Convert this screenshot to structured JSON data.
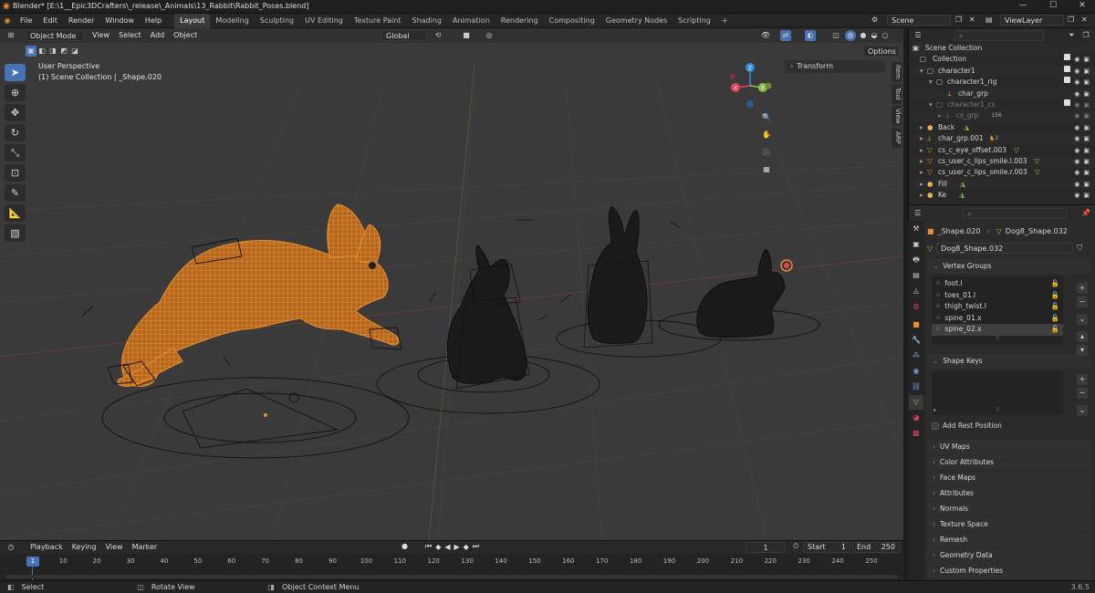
{
  "window": {
    "title": "Blender* [E:\\1__Epic3DCrafters\\_release\\_Animals\\13_Rabbit\\Rabbit_Poses.blend]",
    "minimize": "—",
    "maximize": "☐",
    "close": "✕"
  },
  "menubar": {
    "items": [
      "File",
      "Edit",
      "Render",
      "Window",
      "Help"
    ],
    "workspace_tabs": [
      "Layout",
      "Modeling",
      "Sculpting",
      "UV Editing",
      "Texture Paint",
      "Shading",
      "Animation",
      "Rendering",
      "Compositing",
      "Geometry Nodes",
      "Scripting"
    ],
    "active_tab": "Layout",
    "add_tab": "+",
    "scene_label": "Scene",
    "view_layer_label": "ViewLayer"
  },
  "viewport": {
    "mode": "Object Mode",
    "menus": [
      "View",
      "Select",
      "Add",
      "Object"
    ],
    "transform_orientation": "Global",
    "options_label": "Options",
    "perspective_text": "User Perspective",
    "collection_text": "(1) Scene Collection | _Shape.020",
    "transform_panel": "Transform",
    "side_tabs": [
      "Item",
      "Tool",
      "View",
      "ARP"
    ],
    "gizmo_axes": [
      "Z",
      "X",
      "Y"
    ]
  },
  "outliner": {
    "search_placeholder": "",
    "root": "Scene Collection",
    "rows": [
      {
        "name": "Collection",
        "dim": false,
        "icon": "collection-icon"
      },
      {
        "name": "character1",
        "dim": false,
        "icon": "collection-icon"
      },
      {
        "name": "character1_rig",
        "dim": false,
        "icon": "collection-icon"
      },
      {
        "name": "char_grp",
        "dim": false,
        "icon": "armature-icon"
      },
      {
        "name": "character1_cs",
        "dim": true,
        "icon": "collection-icon"
      },
      {
        "name": "cs_grp",
        "dim": true,
        "icon": "empty-icon",
        "badge": "156"
      },
      {
        "name": "Back",
        "dim": false,
        "icon": "light-icon"
      },
      {
        "name": "char_grp.001",
        "dim": false,
        "icon": "armature-icon",
        "badge": "2"
      },
      {
        "name": "cs_c_eye_offset.003",
        "dim": false,
        "icon": "mesh-icon"
      },
      {
        "name": "cs_user_c_lips_smile.l.003",
        "dim": false,
        "icon": "mesh-icon"
      },
      {
        "name": "cs_user_c_lips_smile.r.003",
        "dim": false,
        "icon": "mesh-icon"
      },
      {
        "name": "Fill",
        "dim": false,
        "icon": "light-icon"
      },
      {
        "name": "Ke",
        "dim": false,
        "icon": "light-icon"
      }
    ]
  },
  "properties": {
    "breadcrumb_object": "_Shape.020",
    "breadcrumb_data": "Dog8_Shape.032",
    "data_name": "Dog8_Shape.032",
    "vertex_groups_title": "Vertex Groups",
    "vertex_groups": [
      "foot.l",
      "toes_01.l",
      "thigh_twist.l",
      "spine_01.x",
      "spine_02.x"
    ],
    "selected_group": "spine_02.x",
    "shape_keys_title": "Shape Keys",
    "add_rest_position": "Add Rest Position",
    "collapsed_panels": [
      "UV Maps",
      "Color Attributes",
      "Face Maps",
      "Attributes",
      "Normals",
      "Texture Space",
      "Remesh",
      "Geometry Data",
      "Custom Properties"
    ]
  },
  "timeline": {
    "menus": [
      "Playback",
      "Keying",
      "View",
      "Marker"
    ],
    "current_frame": "1",
    "start_label": "Start",
    "start_value": "1",
    "end_label": "End",
    "end_value": "250",
    "frame_marker": "1",
    "ticks": [
      "10",
      "20",
      "30",
      "40",
      "50",
      "60",
      "70",
      "80",
      "90",
      "100",
      "110",
      "120",
      "130",
      "140",
      "150",
      "160",
      "170",
      "180",
      "190",
      "200",
      "210",
      "220",
      "230",
      "240",
      "250"
    ]
  },
  "statusbar": {
    "items": [
      "Select",
      "Rotate View",
      "Object Context Menu"
    ],
    "version": "3.6.5"
  },
  "colors": {
    "selected_orange": "#e8902c",
    "active_blue": "#4772b3",
    "x_axis": "#e4425a",
    "y_axis": "#8bc34a",
    "z_axis": "#2f8fe6"
  }
}
